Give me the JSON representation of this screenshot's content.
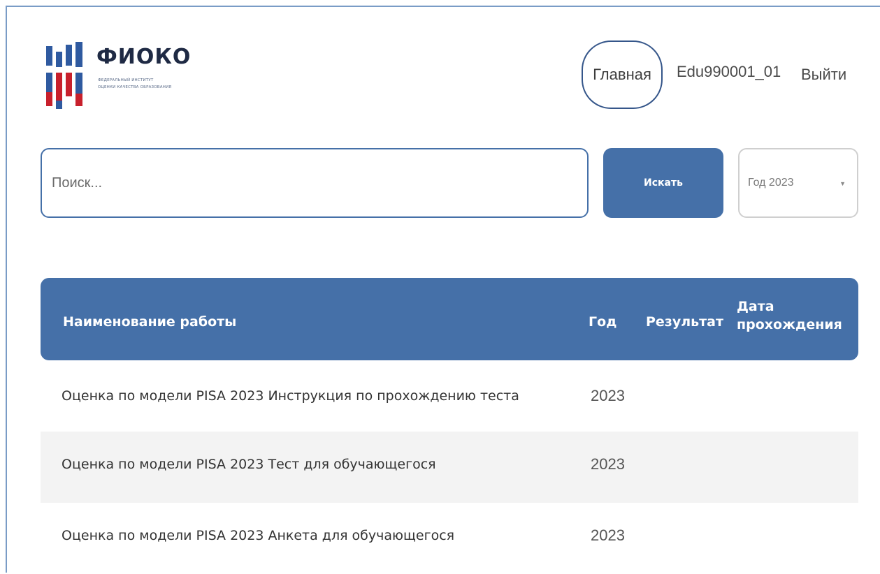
{
  "logo": {
    "title": "ФИОКО",
    "subtitle_line1": "ФЕДЕРАЛЬНЫЙ ИНСТИТУТ",
    "subtitle_line2": "ОЦЕНКИ КАЧЕСТВА ОБРАЗОВАНИЯ",
    "colors": {
      "blue": "#2f5aa0",
      "red": "#c8202c",
      "white": "#ffffff"
    }
  },
  "nav": {
    "home_label": "Главная",
    "user_label": "Edu990001_01",
    "logout_label": "Выйти"
  },
  "search": {
    "placeholder": "Поиск...",
    "button_label": "Искать",
    "year_value": "Год 2023"
  },
  "table": {
    "headers": {
      "name": "Наименование работы",
      "year": "Год",
      "result": "Результат",
      "date": "Дата прохождения"
    },
    "rows": [
      {
        "name": "Оценка по модели PISA 2023 Инструкция по прохождению теста",
        "year": "2023",
        "result": "",
        "date": ""
      },
      {
        "name": "Оценка по модели PISA 2023 Тест для обучающегося",
        "year": "2023",
        "result": "",
        "date": ""
      },
      {
        "name": "Оценка по модели PISA 2023 Анкета для обучающегося",
        "year": "2023",
        "result": "",
        "date": ""
      }
    ]
  },
  "colors": {
    "accent": "#4570a8",
    "row_alt": "#f3f3f3"
  }
}
